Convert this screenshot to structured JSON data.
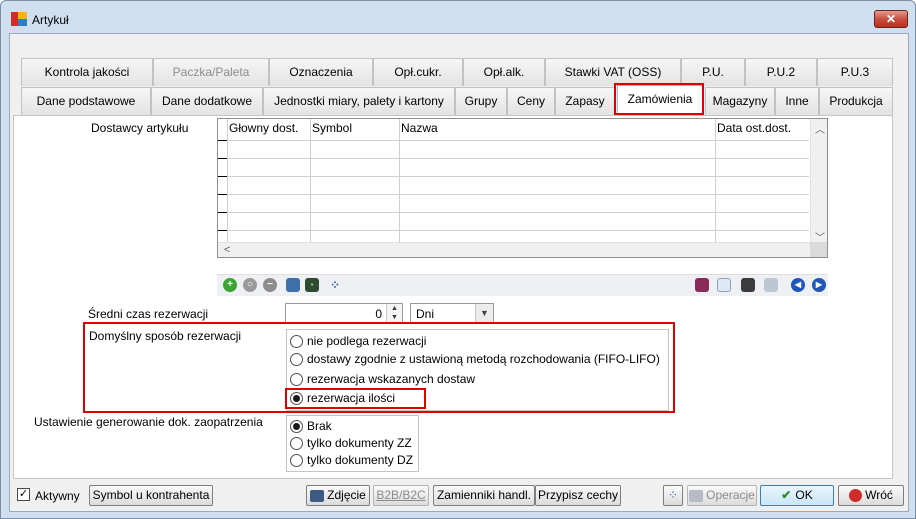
{
  "window": {
    "title": "Artykuł",
    "close_icon": "close-icon"
  },
  "tabs_row1": [
    {
      "label": "Kontrola jakości",
      "enabled": true
    },
    {
      "label": "Paczka/Paleta",
      "enabled": false
    },
    {
      "label": "Oznaczenia",
      "enabled": true
    },
    {
      "label": "Opł.cukr.",
      "enabled": true
    },
    {
      "label": "Opł.alk.",
      "enabled": true
    },
    {
      "label": "Stawki VAT (OSS)",
      "enabled": true
    },
    {
      "label": "P.U.",
      "enabled": true
    },
    {
      "label": "P.U.2",
      "enabled": true
    },
    {
      "label": "P.U.3",
      "enabled": true
    }
  ],
  "tabs_row2": [
    {
      "label": "Dane podstawowe"
    },
    {
      "label": "Dane dodatkowe"
    },
    {
      "label": "Jednostki miary, palety i kartony"
    },
    {
      "label": "Grupy"
    },
    {
      "label": "Ceny"
    },
    {
      "label": "Zapasy"
    },
    {
      "label": "Zamówienia",
      "selected": true
    },
    {
      "label": "Magazyny"
    },
    {
      "label": "Inne"
    },
    {
      "label": "Produkcja"
    }
  ],
  "suppliers": {
    "label": "Dostawcy artykułu",
    "columns": [
      "Głowny dost.",
      "Symbol",
      "Nazwa",
      "Data ost.dost."
    ],
    "rows": []
  },
  "grid_toolbar": {
    "left_icons": [
      "add-icon",
      "zoom-icon",
      "remove-icon",
      "picture-icon",
      "terminal-icon",
      "grid-icon"
    ],
    "right_icons": [
      "book-icon",
      "document-icon",
      "save-icon",
      "copy-icon",
      "nav-prev-icon",
      "nav-next-icon"
    ]
  },
  "reservation_time": {
    "label": "Średni czas rezerwacji",
    "value": "0",
    "unit": "Dni"
  },
  "default_reservation": {
    "label": "Domyślny sposób rezerwacji",
    "options": [
      "nie podlega rezerwacji",
      "dostawy zgodnie z ustawioną metodą rozchodowania (FIFO-LIFO)",
      "rezerwacja wskazanych dostaw",
      "rezerwacja ilości"
    ],
    "selected": 3
  },
  "supply_docs": {
    "label": "Ustawienie generowanie dok. zaopatrzenia",
    "options": [
      "Brak",
      "tylko dokumenty ZZ",
      "tylko dokumenty DZ"
    ],
    "selected": 0
  },
  "footer": {
    "active_label": "Aktywny",
    "active_checked": true,
    "symbol_btn": "Symbol u kontrahenta",
    "photo_btn": "Zdjęcie",
    "b2b_btn": "B2B/B2C",
    "substitutes_btn": "Zamienniki handl.",
    "assign_btn": "Przypisz cechy",
    "operations_btn": "Operacje",
    "ok_btn": "OK",
    "back_btn": "Wróć"
  },
  "colors": {
    "highlight": "#e10000",
    "window_frame": "#cfdff0"
  }
}
